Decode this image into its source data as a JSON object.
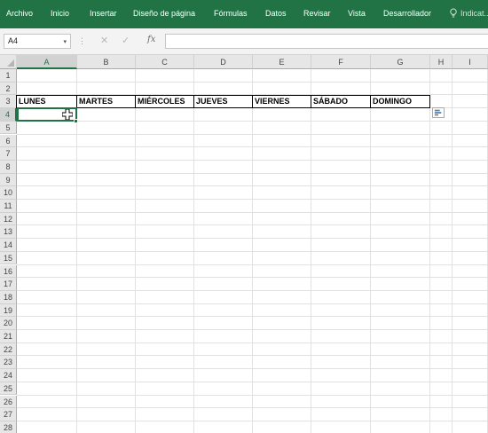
{
  "ribbon": {
    "tabs": [
      "Archivo",
      "Inicio",
      "Insertar",
      "Diseño de página",
      "Fórmulas",
      "Datos",
      "Revisar",
      "Vista",
      "Desarrollador"
    ],
    "tell_me": "Indicat..."
  },
  "formula_bar": {
    "name_box": "A4",
    "name_box_arrow": "▾",
    "cancel_glyph": "✕",
    "enter_glyph": "✓",
    "fx_label": "fx",
    "formula_value": ""
  },
  "grid": {
    "columns": [
      "A",
      "B",
      "C",
      "D",
      "E",
      "F",
      "G",
      "H",
      "I"
    ],
    "rows": [
      "1",
      "2",
      "3",
      "4",
      "5",
      "6",
      "7",
      "8",
      "9",
      "10",
      "11",
      "12",
      "13",
      "14",
      "15",
      "16",
      "17",
      "18",
      "19",
      "20",
      "21",
      "22",
      "23",
      "24",
      "25",
      "26",
      "27",
      "28"
    ],
    "active_cell": "A4",
    "header_row": {
      "row": "3",
      "cells": [
        "LUNES",
        "MARTES",
        "MIÉRCOLES",
        "JUEVES",
        "VIERNES",
        "SÁBADO",
        "DOMINGO"
      ]
    }
  },
  "colors": {
    "ribbon_bg": "#217346",
    "selection": "#217346",
    "header_bg": "#e6e6e6",
    "gridline": "#e1e1e1"
  },
  "icons": [
    "lightbulb-icon",
    "cancel-icon",
    "enter-icon",
    "function-icon",
    "select-all-triangle-icon",
    "crosshair-cursor-icon",
    "quick-analysis-icon"
  ]
}
